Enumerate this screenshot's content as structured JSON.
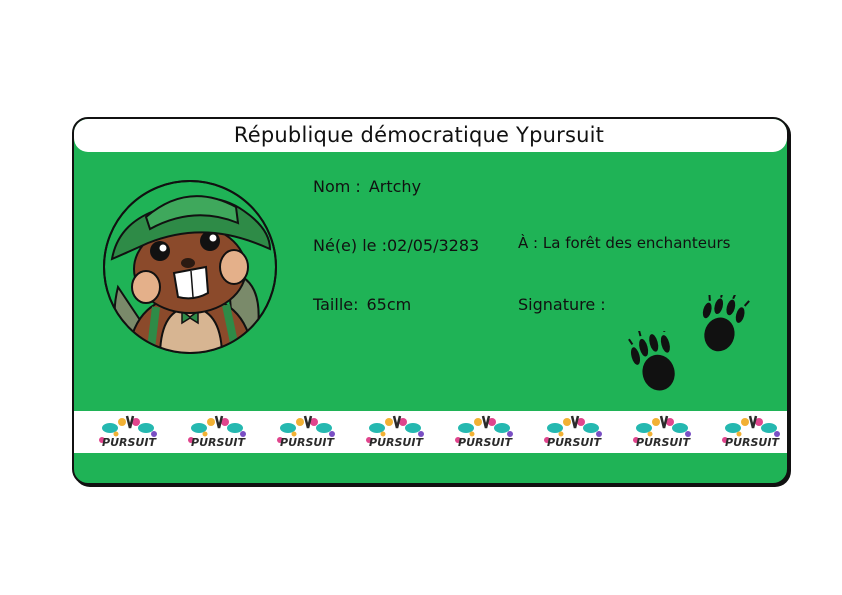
{
  "card": {
    "title": "République démocratique Ypursuit",
    "name_label": "Nom :",
    "name_value": "Artchy",
    "birth_label": "Né(e) le :",
    "birth_value": "02/05/3283",
    "place_label": "À :",
    "place_value": "La forêt des enchanteurs",
    "height_label": "Taille:",
    "height_value": "65cm",
    "signature_label": "Signature :"
  },
  "logo_strip": {
    "logo_text": "PURSUIT",
    "count": 8
  },
  "colors": {
    "card_green": "#1fb356",
    "border": "#111111",
    "hat_green": "#2e8b47"
  },
  "icons": {
    "portrait": "beaver-mascot-icon",
    "signature": "paw-print-icon",
    "logo": "ypursuit-logo-icon"
  }
}
